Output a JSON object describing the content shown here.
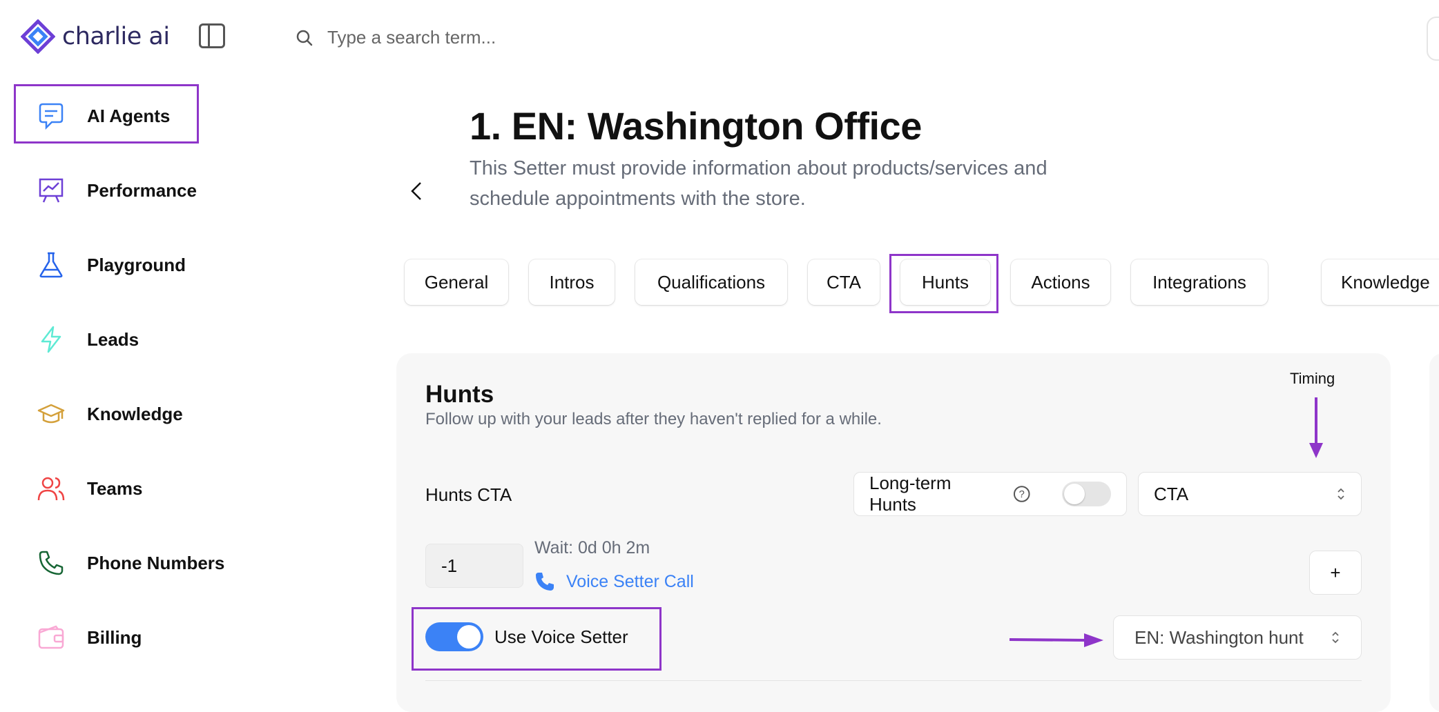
{
  "app": {
    "name": "charlie ai"
  },
  "search": {
    "placeholder": "Type a search term..."
  },
  "sidebar": {
    "items": [
      {
        "label": "AI Agents"
      },
      {
        "label": "Performance"
      },
      {
        "label": "Playground"
      },
      {
        "label": "Leads"
      },
      {
        "label": "Knowledge"
      },
      {
        "label": "Teams"
      },
      {
        "label": "Phone Numbers"
      },
      {
        "label": "Billing"
      }
    ]
  },
  "header": {
    "title": "1. EN: Washington Office",
    "description": "This Setter must provide information about products/services and schedule appointments with the store."
  },
  "tabs": [
    {
      "label": "General"
    },
    {
      "label": "Intros"
    },
    {
      "label": "Qualifications"
    },
    {
      "label": "CTA"
    },
    {
      "label": "Hunts"
    },
    {
      "label": "Actions"
    },
    {
      "label": "Integrations"
    },
    {
      "label": "Knowledge"
    }
  ],
  "hunts": {
    "title": "Hunts",
    "subtitle": "Follow up with your leads after they haven't replied for a while.",
    "cta_label": "Hunts CTA",
    "long_term_label": "Long-term Hunts",
    "long_term_enabled": false,
    "cta_select_value": "CTA",
    "step_value": "-1",
    "wait_text": "Wait: 0d 0h 2m",
    "voice_call_label": "Voice Setter Call",
    "add_label": "+",
    "use_voice_setter_label": "Use Voice Setter",
    "use_voice_setter_enabled": true,
    "hunt_select_value": "EN: Washington hunt"
  },
  "annotations": {
    "timing_label": "Timing"
  },
  "colors": {
    "accent": "#8e35c9",
    "primary": "#3b82f6"
  }
}
